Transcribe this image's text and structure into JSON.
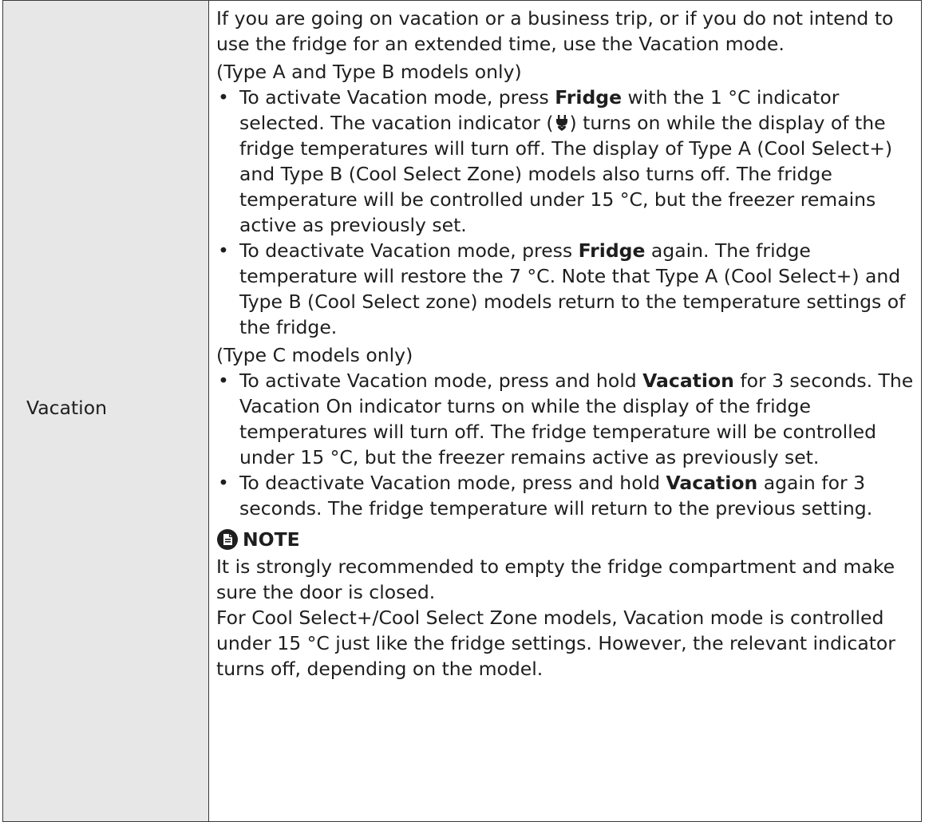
{
  "row": {
    "label": "Vacation",
    "intro": "If you are going on vacation or a business trip, or if you do not intend to use the fridge for an extended time, use the Vacation mode.",
    "section_ab": {
      "heading": "(Type A and Type B models only)",
      "bullet1": {
        "t1": "To activate Vacation mode, press ",
        "b1": "Fridge",
        "t2": " with the 1 °C indicator selected. The vacation indicator (",
        "icon": "vacation-plug-icon",
        "t3": ") turns on while the display of the fridge temperatures will turn off. The display of Type A (Cool Select+) and Type B (Cool Select Zone) models also turns off. The fridge temperature will be controlled under 15 °C, but the freezer remains active as previously set."
      },
      "bullet2": {
        "t1": "To deactivate Vacation mode, press ",
        "b1": "Fridge",
        "t2": " again. The fridge temperature will restore the 7 °C. Note that Type A (Cool Select+) and Type B (Cool Select zone) models return to the temperature settings of the fridge."
      }
    },
    "section_c": {
      "heading": "(Type C models only)",
      "bullet1": {
        "t1": "To activate Vacation mode, press and hold ",
        "b1": "Vacation",
        "t2": " for 3 seconds. The Vacation On indicator turns on while the display of the fridge temperatures will turn off. The fridge temperature will be controlled under 15 °C, but the freezer remains active as previously set."
      },
      "bullet2": {
        "t1": "To deactivate Vacation mode, press and hold ",
        "b1": "Vacation",
        "t2": " again for 3 seconds. The fridge temperature will return to the previous setting."
      }
    },
    "note": {
      "icon": "note-icon",
      "title": "NOTE",
      "p1": "It is strongly recommended to empty the fridge compartment and make sure the door is closed.",
      "p2": "For Cool Select+/Cool Select Zone models, Vacation mode is controlled under 15 °C just like the fridge settings. However, the relevant indicator turns off, depending on the model."
    }
  }
}
